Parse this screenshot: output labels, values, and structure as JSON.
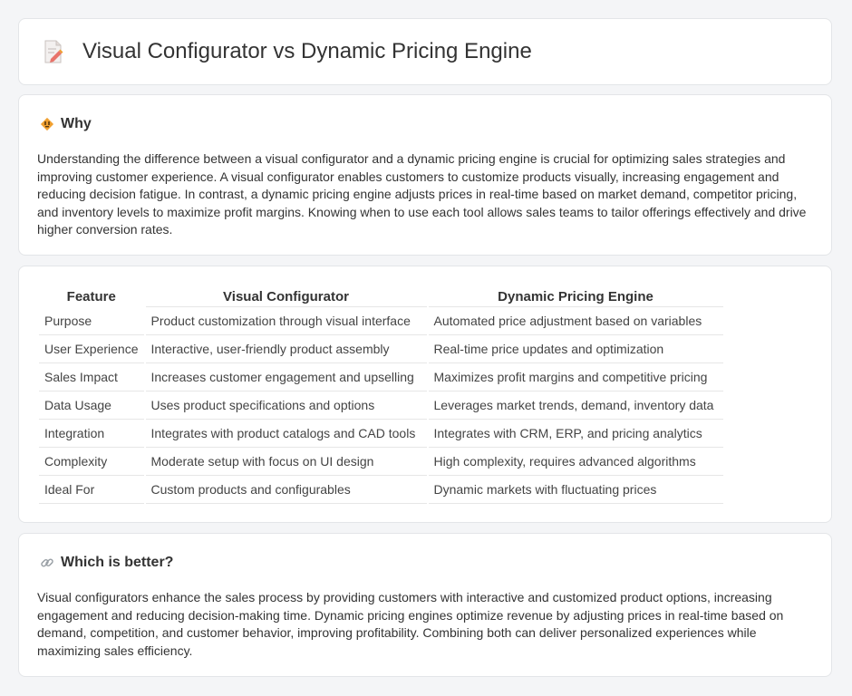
{
  "header": {
    "title": "Visual Configurator vs Dynamic Pricing Engine",
    "icon": "document-pencil-icon"
  },
  "why": {
    "heading": "Why",
    "icon": "diamond-warning-icon",
    "text": "Understanding the difference between a visual configurator and a dynamic pricing engine is crucial for optimizing sales strategies and improving customer experience. A visual configurator enables customers to customize products visually, increasing engagement and reducing decision fatigue. In contrast, a dynamic pricing engine adjusts prices in real-time based on market demand, competitor pricing, and inventory levels to maximize profit margins. Knowing when to use each tool allows sales teams to tailor offerings effectively and drive higher conversion rates."
  },
  "table": {
    "headers": [
      "Feature",
      "Visual Configurator",
      "Dynamic Pricing Engine"
    ],
    "rows": [
      [
        "Purpose",
        "Product customization through visual interface",
        "Automated price adjustment based on variables"
      ],
      [
        "User Experience",
        "Interactive, user-friendly product assembly",
        "Real-time price updates and optimization"
      ],
      [
        "Sales Impact",
        "Increases customer engagement and upselling",
        "Maximizes profit margins and competitive pricing"
      ],
      [
        "Data Usage",
        "Uses product specifications and options",
        "Leverages market trends, demand, inventory data"
      ],
      [
        "Integration",
        "Integrates with product catalogs and CAD tools",
        "Integrates with CRM, ERP, and pricing analytics"
      ],
      [
        "Complexity",
        "Moderate setup with focus on UI design",
        "High complexity, requires advanced algorithms"
      ],
      [
        "Ideal For",
        "Custom products and configurables",
        "Dynamic markets with fluctuating prices"
      ]
    ]
  },
  "better": {
    "heading": "Which is better?",
    "icon": "link-icon",
    "text": "Visual configurators enhance the sales process by providing customers with interactive and customized product options, increasing engagement and reducing decision-making time. Dynamic pricing engines optimize revenue by adjusting prices in real-time based on demand, competition, and customer behavior, improving profitability. Combining both can deliver personalized experiences while maximizing sales efficiency."
  },
  "colors": {
    "accent_orange": "#f0a030",
    "icon_pink": "#e8736a",
    "link_gray": "#9aa0a6"
  }
}
